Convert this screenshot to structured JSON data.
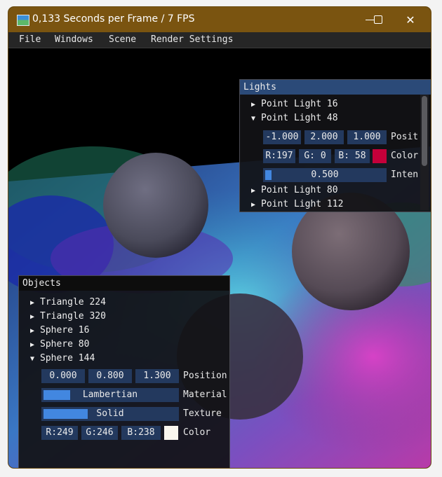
{
  "window": {
    "title": "0,133 Seconds per Frame / 7 FPS",
    "icon": "app-icon",
    "minimize_glyph": "—",
    "maximize_glyph": "☐",
    "close_glyph": "✕"
  },
  "menu": [
    "File",
    "Windows",
    "Scene",
    "Render Settings"
  ],
  "lights_panel": {
    "title": "Lights",
    "items": [
      {
        "label": "Point Light 16",
        "expanded": false
      },
      {
        "label": "Point Light 48",
        "expanded": true
      },
      {
        "label": "Point Light 80",
        "expanded": false
      },
      {
        "label": "Point Light 112",
        "expanded": false
      }
    ],
    "expanded": {
      "position": [
        "-1.000",
        "2.000",
        "1.000"
      ],
      "position_label": "Position",
      "color": [
        "R:197",
        "G:  0",
        "B: 58"
      ],
      "color_label": "Color",
      "color_hex": "#c5003a",
      "intensity": "0.500",
      "intensity_label": "Intensity",
      "intensity_fraction": 0.05
    }
  },
  "objects_panel": {
    "title": "Objects",
    "items": [
      {
        "label": "Triangle 224",
        "expanded": false
      },
      {
        "label": "Triangle 320",
        "expanded": false
      },
      {
        "label": "Sphere 16",
        "expanded": false
      },
      {
        "label": "Sphere 80",
        "expanded": false
      },
      {
        "label": "Sphere 144",
        "expanded": true
      }
    ],
    "expanded": {
      "position": [
        "0.000",
        "0.800",
        "1.300"
      ],
      "position_label": "Position",
      "material": "Lambertian",
      "material_label": "Material",
      "material_fraction": 0.2,
      "texture": "Solid",
      "texture_label": "Texture",
      "texture_fraction": 0.33,
      "color": [
        "R:249",
        "G:246",
        "B:238"
      ],
      "color_label": "Color",
      "color_hex": "#f9f6ee"
    }
  },
  "glyphs": {
    "collapsed": "▶",
    "expanded": "▼"
  }
}
